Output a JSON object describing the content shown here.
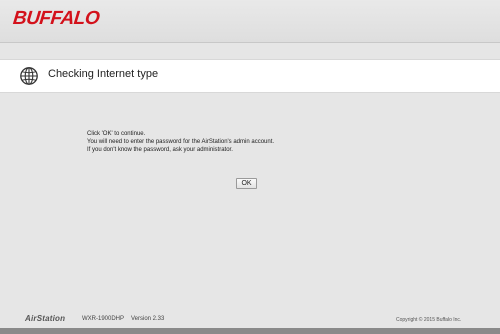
{
  "header": {
    "logo_text": "BUFFALO",
    "brand_color": "#d3111b"
  },
  "title_bar": {
    "icon": "globe-icon",
    "title": "Checking Internet type"
  },
  "message": {
    "line1": "Click 'OK' to continue.",
    "line2": "You will need to enter the password for the AirStation's admin account.",
    "line3": "If you don't know the password, ask your administrator."
  },
  "ok_button": {
    "label": "OK"
  },
  "footer": {
    "brand": "AirStation",
    "model": "WXR-1900DHP",
    "version": "Version 2.33",
    "copyright": "Copyright © 2015 Buffalo Inc."
  }
}
